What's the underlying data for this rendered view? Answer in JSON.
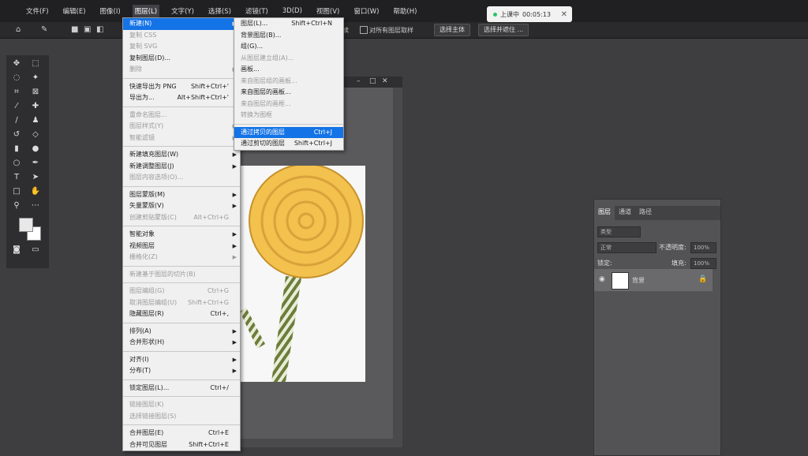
{
  "menubar": {
    "items": [
      "文件(F)",
      "编辑(E)",
      "图像(I)",
      "图层(L)",
      "文字(Y)",
      "选择(S)",
      "滤镜(T)",
      "3D(D)",
      "视图(V)",
      "窗口(W)",
      "帮助(H)"
    ]
  },
  "recording": {
    "status": "上课中",
    "time": "00:05:13",
    "close": "✕"
  },
  "options": {
    "partial_text": "续",
    "sample_all_layers": "对所有图层取样",
    "select_subject": "选择主体",
    "select_and_mask": "选择并遮住 ..."
  },
  "layer_menu": [
    {
      "label": "新建(N)",
      "shortcut": "",
      "arrow": true,
      "disabled": false,
      "highlight": true
    },
    {
      "label": "复制 CSS",
      "disabled": true
    },
    {
      "label": "复制 SVG",
      "disabled": true
    },
    {
      "label": "复制图层(D)...",
      "disabled": false
    },
    {
      "label": "删除",
      "disabled": true,
      "arrow": true
    },
    {
      "sep": true
    },
    {
      "label": "快速导出为 PNG",
      "shortcut": "Shift+Ctrl+'"
    },
    {
      "label": "导出为...",
      "shortcut": "Alt+Shift+Ctrl+'"
    },
    {
      "sep": true
    },
    {
      "label": "重命名图层...",
      "disabled": true
    },
    {
      "label": "图层样式(Y)",
      "disabled": true,
      "arrow": true
    },
    {
      "label": "智能滤镜",
      "disabled": true,
      "arrow": true
    },
    {
      "sep": true
    },
    {
      "label": "新建填充图层(W)",
      "arrow": true
    },
    {
      "label": "新建调整图层(J)",
      "arrow": true
    },
    {
      "label": "图层内容选项(O)...",
      "disabled": true
    },
    {
      "sep": true
    },
    {
      "label": "图层蒙版(M)",
      "arrow": true
    },
    {
      "label": "矢量蒙版(V)",
      "arrow": true
    },
    {
      "label": "创建剪贴蒙版(C)",
      "shortcut": "Alt+Ctrl+G",
      "disabled": true
    },
    {
      "sep": true
    },
    {
      "label": "智能对象",
      "arrow": true
    },
    {
      "label": "视频图层",
      "arrow": true
    },
    {
      "label": "栅格化(Z)",
      "disabled": true,
      "arrow": true
    },
    {
      "sep": true
    },
    {
      "label": "新建基于图层的切片(B)",
      "disabled": true
    },
    {
      "sep": true
    },
    {
      "label": "图层编组(G)",
      "shortcut": "Ctrl+G",
      "disabled": true
    },
    {
      "label": "取消图层编组(U)",
      "shortcut": "Shift+Ctrl+G",
      "disabled": true
    },
    {
      "label": "隐藏图层(R)",
      "shortcut": "Ctrl+,"
    },
    {
      "sep": true
    },
    {
      "label": "排列(A)",
      "arrow": true
    },
    {
      "label": "合并形状(H)",
      "arrow": true
    },
    {
      "sep": true
    },
    {
      "label": "对齐(I)",
      "arrow": true
    },
    {
      "label": "分布(T)",
      "arrow": true
    },
    {
      "sep": true
    },
    {
      "label": "锁定图层(L)...",
      "shortcut": "Ctrl+/"
    },
    {
      "sep": true
    },
    {
      "label": "链接图层(K)",
      "disabled": true
    },
    {
      "label": "选择链接图层(S)",
      "disabled": true
    },
    {
      "sep": true
    },
    {
      "label": "合并图层(E)",
      "shortcut": "Ctrl+E"
    },
    {
      "label": "合并可见图层",
      "shortcut": "Shift+Ctrl+E"
    }
  ],
  "new_submenu": [
    {
      "label": "图层(L)...",
      "shortcut": "Shift+Ctrl+N"
    },
    {
      "label": "背景图层(B)..."
    },
    {
      "label": "组(G)..."
    },
    {
      "label": "从图层建立组(A)...",
      "disabled": true
    },
    {
      "label": "画板..."
    },
    {
      "label": "来自图层组的画板...",
      "disabled": true
    },
    {
      "label": "来自图层的画板..."
    },
    {
      "label": "来自图层的画框...",
      "disabled": true
    },
    {
      "label": "转换为图框",
      "disabled": true
    },
    {
      "sep": true
    },
    {
      "label": "通过拷贝的图层",
      "shortcut": "Ctrl+J",
      "highlight": true
    },
    {
      "label": "通过剪切的图层",
      "shortcut": "Shift+Ctrl+J"
    }
  ],
  "layers_panel": {
    "tabs": [
      "图层",
      "通道",
      "路径"
    ],
    "kind_placeholder": "类型",
    "blend_mode": "正常",
    "opacity_label": "不透明度:",
    "opacity_value": "100%",
    "lock_label": "锁定:",
    "fill_label": "填充:",
    "fill_value": "100%",
    "layer_name": "背景"
  },
  "colors": {
    "highlight": "#1473e6",
    "candy": "#f2c14e",
    "stick": "#6b7d3a"
  }
}
